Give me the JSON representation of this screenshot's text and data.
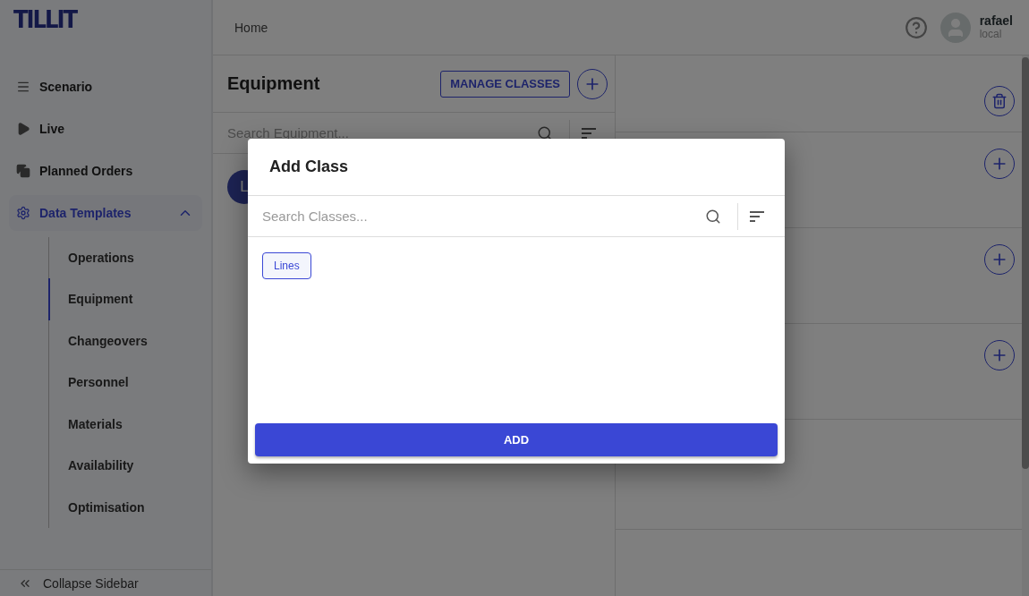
{
  "logo": "TILLIT",
  "sidebar": {
    "items": [
      {
        "label": "Scenario",
        "selected": false
      },
      {
        "label": "Live",
        "selected": false
      },
      {
        "label": "Planned Orders",
        "selected": false
      },
      {
        "label": "Data Templates",
        "selected": true,
        "expanded": true,
        "children": [
          {
            "label": "Operations",
            "selected": false
          },
          {
            "label": "Equipment",
            "selected": true
          },
          {
            "label": "Changeovers",
            "selected": false
          },
          {
            "label": "Personnel",
            "selected": false
          },
          {
            "label": "Materials",
            "selected": false
          },
          {
            "label": "Availability",
            "selected": false
          },
          {
            "label": "Optimisation",
            "selected": false
          }
        ]
      }
    ],
    "collapse": "Collapse Sidebar"
  },
  "header": {
    "breadcrumb": "Home",
    "user": {
      "name": "rafael",
      "role": "local"
    }
  },
  "equipment_panel": {
    "title": "Equipment",
    "manage_button": "MANAGE CLASSES",
    "search": {
      "placeholder": "Search Equipment..."
    },
    "items": [
      {
        "avatar": "L"
      }
    ]
  },
  "detail_panel": {
    "rows": [
      {
        "kind": "delete"
      },
      {
        "kind": "add"
      },
      {
        "kind": "add"
      },
      {
        "kind": "add"
      },
      {
        "kind": "empty"
      },
      {
        "kind": "empty"
      }
    ]
  },
  "dialog": {
    "title": "Add Class",
    "search": {
      "placeholder": "Search Classes..."
    },
    "classes": [
      {
        "label": "Lines",
        "selected": true
      }
    ],
    "submit": "ADD"
  }
}
